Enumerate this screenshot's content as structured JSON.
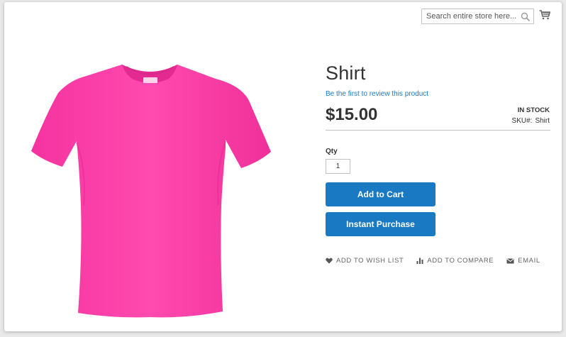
{
  "header": {
    "search_placeholder": "Search entire store here..."
  },
  "product": {
    "title": "Shirt",
    "review_link": "Be the first to review this product",
    "price": "$15.00",
    "stock": "IN STOCK",
    "sku_label": "SKU#:",
    "sku_value": "Shirt",
    "image_color": "#ff3fa8"
  },
  "purchase": {
    "qty_label": "Qty",
    "qty_value": "1",
    "add_to_cart": "Add to Cart",
    "instant_purchase": "Instant Purchase"
  },
  "actions": {
    "wishlist": "ADD TO WISH LIST",
    "compare": "ADD TO COMPARE",
    "email": "EMAIL"
  },
  "colors": {
    "primary": "#1979c3",
    "text": "#333333"
  }
}
